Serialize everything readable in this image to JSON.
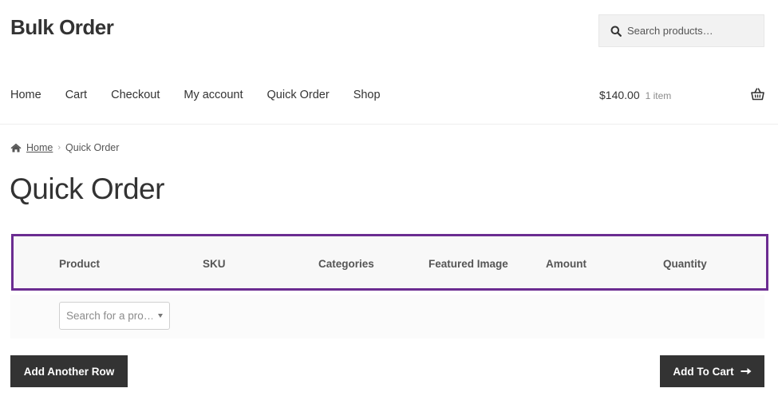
{
  "site": {
    "title": "Bulk Order"
  },
  "search": {
    "placeholder": "Search products…"
  },
  "nav": {
    "items": [
      {
        "label": "Home"
      },
      {
        "label": "Cart"
      },
      {
        "label": "Checkout"
      },
      {
        "label": "My account"
      },
      {
        "label": "Quick Order"
      },
      {
        "label": "Shop"
      }
    ]
  },
  "cart": {
    "amount": "$140.00",
    "count": "1 item"
  },
  "breadcrumb": {
    "home": "Home",
    "current": "Quick Order"
  },
  "page": {
    "title": "Quick Order"
  },
  "table": {
    "headers": [
      "Product",
      "SKU",
      "Categories",
      "Featured Image",
      "Amount",
      "Quantity"
    ],
    "row": {
      "product_select_placeholder": "Search for a pro…"
    }
  },
  "buttons": {
    "add_row": "Add Another Row",
    "add_to_cart": "Add To Cart"
  },
  "colors": {
    "accent_border": "#6b2c91",
    "button_bg": "#333333",
    "text": "#333333"
  },
  "icons": {
    "search": "search-icon",
    "cart": "basket-icon",
    "home": "home-icon",
    "arrow": "arrow-right-icon"
  }
}
